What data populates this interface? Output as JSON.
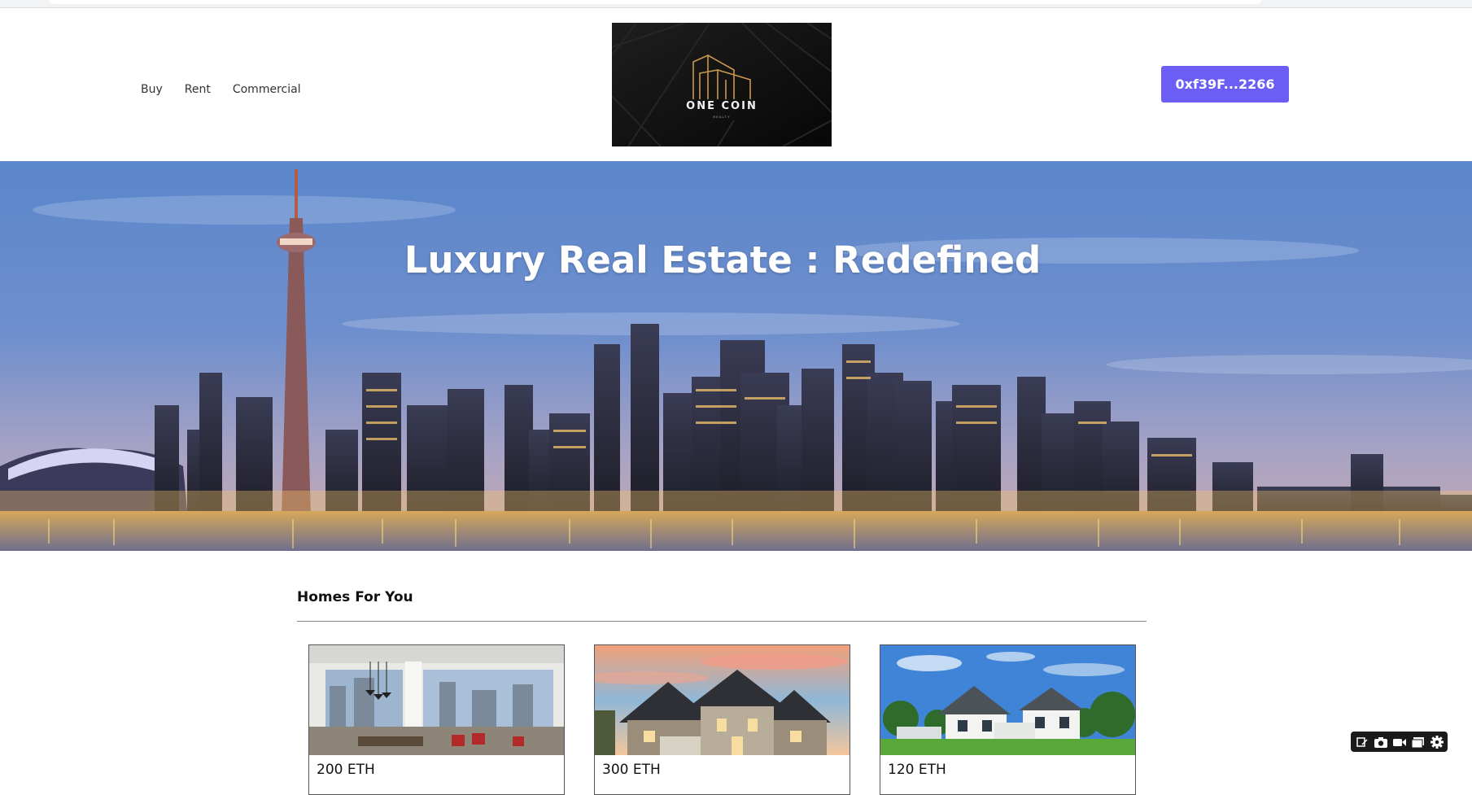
{
  "header": {
    "nav": [
      "Buy",
      "Rent",
      "Commercial"
    ],
    "logo_text": "ONE COIN",
    "logo_subtext": "REALTY",
    "wallet_label": "0xf39F...2266"
  },
  "hero": {
    "title": "Luxury Real Estate : Redefined"
  },
  "listings": {
    "section_title": "Homes For You",
    "cards": [
      {
        "price": "200 ETH",
        "image": "interior-living-room"
      },
      {
        "price": "300 ETH",
        "image": "house-at-sunset"
      },
      {
        "price": "120 ETH",
        "image": "white-house-lawn"
      }
    ]
  },
  "toolbar": {
    "icons": [
      "screenshot-edit-icon",
      "camera-icon",
      "video-icon",
      "window-icon",
      "gear-icon"
    ]
  },
  "colors": {
    "accent": "#6c5ef5",
    "logo_gold": "#c8994a"
  }
}
